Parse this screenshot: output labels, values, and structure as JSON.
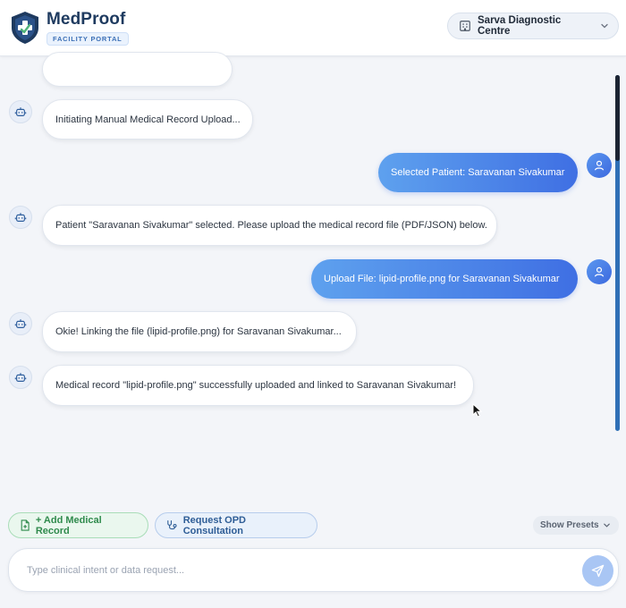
{
  "app": {
    "name": "MedProof",
    "badge": "FACILITY PORTAL"
  },
  "facility": {
    "name": "Sarva Diagnostic Centre"
  },
  "messages": [
    {
      "role": "bot",
      "text": ""
    },
    {
      "role": "bot",
      "text": "Initiating Manual Medical Record Upload..."
    },
    {
      "role": "user",
      "text": "Selected Patient: Saravanan Sivakumar"
    },
    {
      "role": "bot",
      "text": "Patient \"Saravanan Sivakumar\" selected. Please upload the medical record file (PDF/JSON) below."
    },
    {
      "role": "user",
      "text": "Upload File: lipid-profile.png for Saravanan Sivakumar"
    },
    {
      "role": "bot",
      "text": "Okie! Linking the file (lipid-profile.png) for Saravanan Sivakumar..."
    },
    {
      "role": "bot",
      "text": "Medical record \"lipid-profile.png\" successfully uploaded and linked to Saravanan Sivakumar!"
    }
  ],
  "actions": {
    "add_record": "+ Add Medical Record",
    "request_opd": "Request OPD Consultation",
    "show_presets": "Show Presets"
  },
  "composer": {
    "placeholder": "Type clinical intent or data request...",
    "value": ""
  },
  "colors": {
    "brand": "#1e3a5f",
    "user_bubble_start": "#5ea1ee",
    "user_bubble_end": "#3f6fe3",
    "add_green": "#2f8a4c",
    "opd_blue": "#2e5d96"
  }
}
